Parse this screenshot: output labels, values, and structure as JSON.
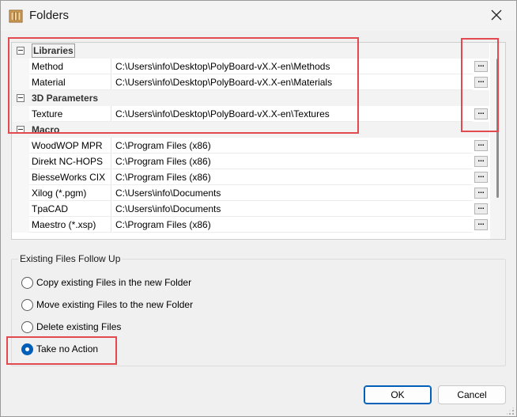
{
  "window": {
    "title": "Folders",
    "close_icon": "close-icon",
    "app_icon": "folders-app-icon"
  },
  "grid": {
    "categories": [
      {
        "label": "Libraries",
        "rows": [
          {
            "name": "Method",
            "value": "C:\\Users\\info\\Desktop\\PolyBoard-vX.X-en\\Methods"
          },
          {
            "name": "Material",
            "value": "C:\\Users\\info\\Desktop\\PolyBoard-vX.X-en\\Materials"
          }
        ]
      },
      {
        "label": "3D Parameters",
        "rows": [
          {
            "name": "Texture",
            "value": "C:\\Users\\info\\Desktop\\PolyBoard-vX.X-en\\Textures"
          }
        ]
      },
      {
        "label": "Macro",
        "rows": [
          {
            "name": "WoodWOP MPR",
            "value": "C:\\Program Files (x86)"
          },
          {
            "name": "Direkt NC-HOPS",
            "value": "C:\\Program Files (x86)"
          },
          {
            "name": "BiesseWorks CIX",
            "value": "C:\\Program Files (x86)"
          },
          {
            "name": "Xilog (*.pgm)",
            "value": "C:\\Users\\info\\Documents"
          },
          {
            "name": "TpaCAD",
            "value": "C:\\Users\\info\\Documents"
          },
          {
            "name": "Maestro (*.xsp)",
            "value": "C:\\Program Files (x86)"
          }
        ]
      }
    ],
    "browse_label": "..."
  },
  "follow_up": {
    "title": "Existing Files Follow Up",
    "options": [
      {
        "label": "Copy existing Files in the new Folder",
        "checked": false
      },
      {
        "label": "Move existing Files to the new Folder",
        "checked": false
      },
      {
        "label": "Delete existing Files",
        "checked": false
      },
      {
        "label": "Take no Action",
        "checked": true
      }
    ]
  },
  "buttons": {
    "ok": "OK",
    "cancel": "Cancel"
  },
  "colors": {
    "highlight": "#e24a4f",
    "accent": "#005fb8"
  }
}
